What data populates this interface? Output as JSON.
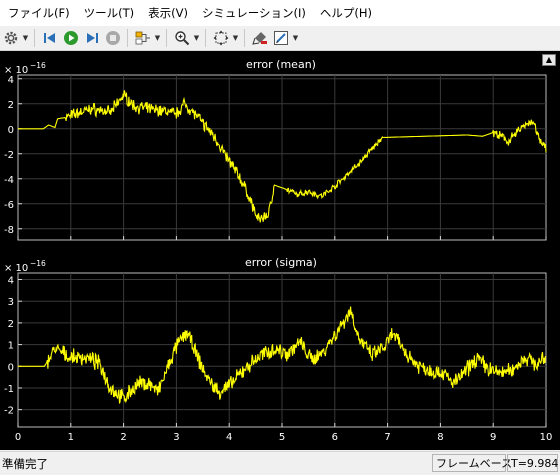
{
  "menu": [
    "ファイル(F)",
    "ツール(T)",
    "表示(V)",
    "シミュレーション(I)",
    "ヘルプ(H)"
  ],
  "toolbar": {
    "icons": [
      "gear-icon",
      "step-back-icon",
      "run-icon",
      "step-forward-icon",
      "stop-icon",
      "signal-tool-icon",
      "zoom-icon",
      "fit-to-view-icon",
      "highlight-icon",
      "style-icon"
    ]
  },
  "plots": [
    {
      "title": "error (mean)",
      "exponent_base": "× 10",
      "exponent_power": "−16",
      "y_ticks": [
        "4",
        "2",
        "0",
        "-2",
        "-4",
        "-6",
        "-8"
      ],
      "y_min": -8.9,
      "y_max": 4.3,
      "trace_color": "#ffff00",
      "anchors": [
        [
          0,
          0
        ],
        [
          0.48,
          0
        ],
        [
          0.58,
          0.3
        ],
        [
          0.7,
          0.1
        ],
        [
          0.75,
          0.8
        ],
        [
          0.9,
          0.9
        ],
        [
          1.1,
          1.2
        ],
        [
          1.4,
          1.6
        ],
        [
          1.75,
          1.3
        ],
        [
          2.0,
          2.7
        ],
        [
          2.2,
          1.8
        ],
        [
          2.45,
          1.6
        ],
        [
          2.8,
          1.4
        ],
        [
          3.0,
          1.2
        ],
        [
          3.15,
          2.0
        ],
        [
          3.35,
          1.2
        ],
        [
          3.55,
          0.2
        ],
        [
          3.75,
          -0.8
        ],
        [
          3.95,
          -2.3
        ],
        [
          4.15,
          -3.5
        ],
        [
          4.35,
          -5.2
        ],
        [
          4.55,
          -7.3
        ],
        [
          4.75,
          -6.8
        ],
        [
          4.85,
          -4.5
        ],
        [
          5.05,
          -4.8
        ],
        [
          5.3,
          -5.3
        ],
        [
          5.5,
          -5.0
        ],
        [
          5.75,
          -5.4
        ],
        [
          6.0,
          -4.6
        ],
        [
          6.25,
          -3.6
        ],
        [
          6.5,
          -2.6
        ],
        [
          6.75,
          -1.4
        ],
        [
          6.9,
          -0.7
        ],
        [
          8.5,
          -0.5
        ],
        [
          8.8,
          -0.6
        ],
        [
          9.0,
          -0.3
        ],
        [
          9.3,
          -1.0
        ],
        [
          9.55,
          0.2
        ],
        [
          9.75,
          0.6
        ],
        [
          9.9,
          -1.2
        ],
        [
          10.0,
          -1.5
        ]
      ],
      "noise_segments": [
        [
          0.9,
          4.85,
          0.6,
          0.55
        ],
        [
          5.1,
          6.9,
          0.25,
          0.35
        ],
        [
          9.0,
          10.0,
          0.45,
          0.5
        ]
      ]
    },
    {
      "title": "error (sigma)",
      "exponent_base": "× 10",
      "exponent_power": "−16",
      "y_ticks": [
        "4",
        "3",
        "2",
        "1",
        "0",
        "-1",
        "-2"
      ],
      "y_min": -2.8,
      "y_max": 4.3,
      "trace_color": "#ffff00",
      "anchors": [
        [
          0,
          0
        ],
        [
          0.5,
          0
        ],
        [
          0.7,
          0.8
        ],
        [
          1.0,
          0.4
        ],
        [
          1.3,
          0.4
        ],
        [
          1.55,
          0.1
        ],
        [
          1.75,
          -1.0
        ],
        [
          2.0,
          -1.5
        ],
        [
          2.15,
          -1.1
        ],
        [
          2.3,
          -0.8
        ],
        [
          2.5,
          -0.8
        ],
        [
          2.65,
          -1.2
        ],
        [
          2.85,
          0.0
        ],
        [
          3.0,
          0.9
        ],
        [
          3.2,
          1.6
        ],
        [
          3.4,
          0.4
        ],
        [
          3.6,
          -0.6
        ],
        [
          3.8,
          -1.2
        ],
        [
          4.05,
          -0.8
        ],
        [
          4.3,
          -0.1
        ],
        [
          4.6,
          0.5
        ],
        [
          4.85,
          0.8
        ],
        [
          5.1,
          0.6
        ],
        [
          5.35,
          1.1
        ],
        [
          5.55,
          0.3
        ],
        [
          5.75,
          0.6
        ],
        [
          6.05,
          1.6
        ],
        [
          6.3,
          2.6
        ],
        [
          6.45,
          1.3
        ],
        [
          6.7,
          0.5
        ],
        [
          6.95,
          0.9
        ],
        [
          7.1,
          1.5
        ],
        [
          7.35,
          0.6
        ],
        [
          7.55,
          0.1
        ],
        [
          7.8,
          -0.2
        ],
        [
          8.05,
          -0.3
        ],
        [
          8.25,
          -0.8
        ],
        [
          8.45,
          -0.3
        ],
        [
          8.7,
          0.4
        ],
        [
          8.9,
          -0.1
        ],
        [
          9.1,
          -0.3
        ],
        [
          9.35,
          -0.2
        ],
        [
          9.6,
          0.4
        ],
        [
          9.85,
          0.1
        ],
        [
          10.0,
          0.4
        ]
      ],
      "noise_segments": [
        [
          0.55,
          10.0,
          0.55,
          0.3
        ]
      ]
    }
  ],
  "x_axis": {
    "min": 0,
    "max": 10,
    "ticks": [
      "0",
      "1",
      "2",
      "3",
      "4",
      "5",
      "6",
      "7",
      "8",
      "9",
      "10"
    ]
  },
  "status": {
    "text": "準備完了",
    "mode": "フレームベース",
    "time": "T=9.984"
  }
}
